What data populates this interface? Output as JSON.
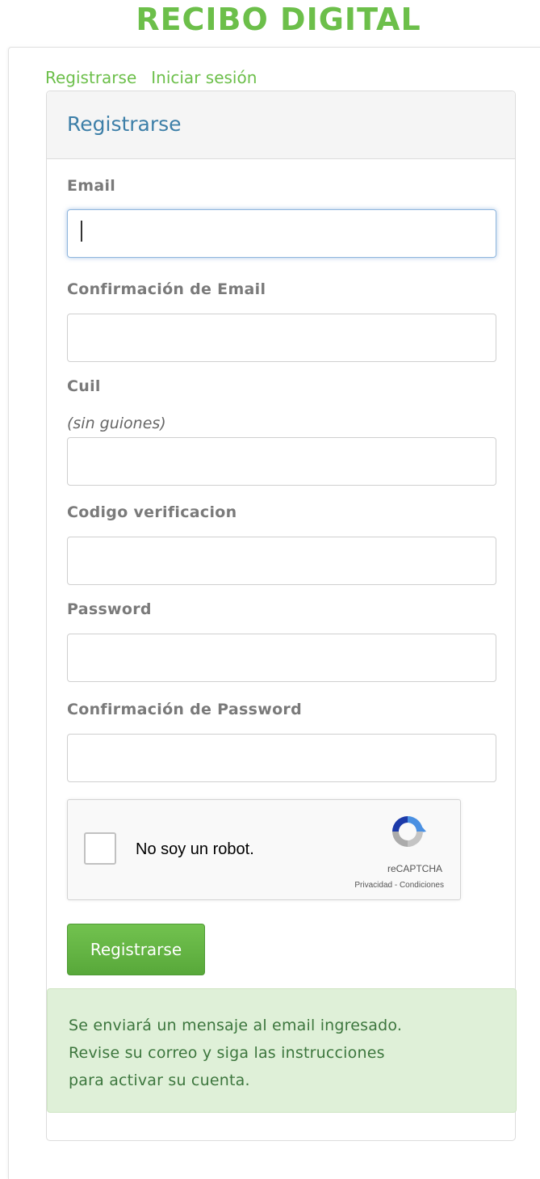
{
  "app": {
    "title": "RECIBO DIGITAL"
  },
  "nav": {
    "register": "Registrarse",
    "login": "Iniciar sesión"
  },
  "panel": {
    "heading": "Registrarse"
  },
  "form": {
    "email": {
      "label": "Email",
      "value": ""
    },
    "email_confirm": {
      "label": "Confirmación de Email",
      "value": ""
    },
    "cuil": {
      "label": "Cuil",
      "hint": "(sin guiones)",
      "value": ""
    },
    "verification_code": {
      "label": "Codigo verificacion",
      "value": ""
    },
    "password": {
      "label": "Password",
      "value": ""
    },
    "password_confirm": {
      "label": "Confirmación de Password",
      "value": ""
    }
  },
  "captcha": {
    "label": "No soy un robot.",
    "brand": "reCAPTCHA",
    "links": "Privacidad - Condiciones",
    "icon": "recaptcha-icon"
  },
  "submit": {
    "label": "Registrarse"
  },
  "alert": {
    "line1": "Se enviará un mensaje al email ingresado.",
    "line2": "Revise su correo y siga las instrucciones",
    "line3": "para activar su cuenta."
  },
  "colors": {
    "brand_green": "#6cbf4a",
    "heading_blue": "#3d7fa8",
    "alert_bg": "#dff0d8",
    "alert_text": "#3c763d"
  }
}
